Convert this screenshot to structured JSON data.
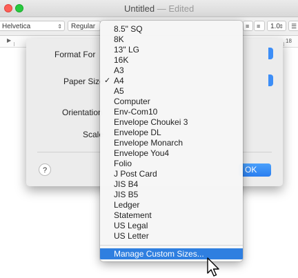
{
  "window": {
    "title": "Untitled",
    "title_separator": "—",
    "edited": "Edited"
  },
  "toolbar": {
    "font_family": "Helvetica",
    "font_style": "Regular",
    "line_spacing": "1.0"
  },
  "ruler": {
    "mark": "18"
  },
  "sheet": {
    "format_for_label": "Format For",
    "paper_size_label": "Paper Size",
    "orientation_label": "Orientation",
    "scale_label": "Scale",
    "help_label": "?",
    "ok_label": "OK"
  },
  "menu": {
    "selected": "A4",
    "items": [
      "8.5\" SQ",
      "8K",
      "13\" LG",
      "16K",
      "A3",
      "A4",
      "A5",
      "Computer",
      "Env-Com10",
      "Envelope Choukei 3",
      "Envelope DL",
      "Envelope Monarch",
      "Envelope You4",
      "Folio",
      "J Post Card",
      "JIS B4",
      "JIS B5",
      "Ledger",
      "Statement",
      "US Legal",
      "US Letter"
    ],
    "manage_label": "Manage Custom Sizes...",
    "checkmark": "✓"
  },
  "colors": {
    "accent": "#2f7fe0",
    "ok_button": "#2a7ef0"
  }
}
